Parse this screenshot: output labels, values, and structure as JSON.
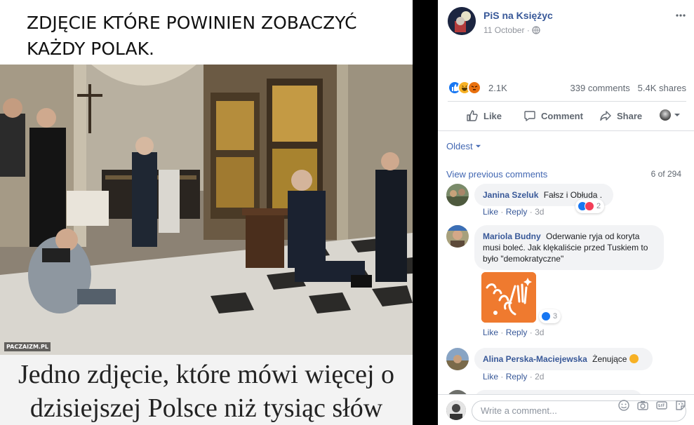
{
  "meme": {
    "top_line1": "ZDJĘCIE KTÓRE POWINIEN ZOBACZYĆ",
    "top_line2": "KAŻDY POLAK.",
    "watermark": "PACZAIZM.PL",
    "bottom_line1": "Jedno zdjęcie, które mówi więcej o",
    "bottom_line2": "dzisiejszej Polsce niż tysiąc słów"
  },
  "post": {
    "page_name": "PiS na Księżyc",
    "date": "11 October",
    "privacy_sep": "·",
    "more_icon": "more-dots-icon",
    "reaction_count": "2.1K",
    "comments_count": "339 comments",
    "shares_count": "5.4K shares",
    "actions": {
      "like": "Like",
      "comment": "Comment",
      "share": "Share"
    }
  },
  "comments_section": {
    "sort_label": "Oldest",
    "view_previous": "View previous comments",
    "position": "6 of 294",
    "comments": [
      {
        "author": "Janina Szeluk",
        "text": "Fałsz i Obłuda .",
        "like": "Like",
        "reply": "Reply",
        "time": "3d",
        "reactions": "2"
      },
      {
        "author": "Mariola Budny",
        "text_line1": "Oderwanie ryja od koryta",
        "text_line2": "musi boleć. Jak klękaliście przed Tuskiem to",
        "text_line3": "było \"demokratyczne\"",
        "like": "Like",
        "reply": "Reply",
        "time": "3d",
        "reactions": "3"
      },
      {
        "author": "Alina Perska-Maciejewska",
        "text": "Żenujące",
        "like": "Like",
        "reply": "Reply",
        "time": "2d"
      }
    ]
  },
  "composer": {
    "placeholder": "Write a comment..."
  },
  "colors": {
    "link_blue": "#385898",
    "action_blue": "#4267b2",
    "like_blue": "#1877f2",
    "love_red": "#f33e58",
    "haha_yellow": "#f7b125",
    "angry_orange": "#e9710f",
    "sticker_orange": "#ef7a2f"
  }
}
